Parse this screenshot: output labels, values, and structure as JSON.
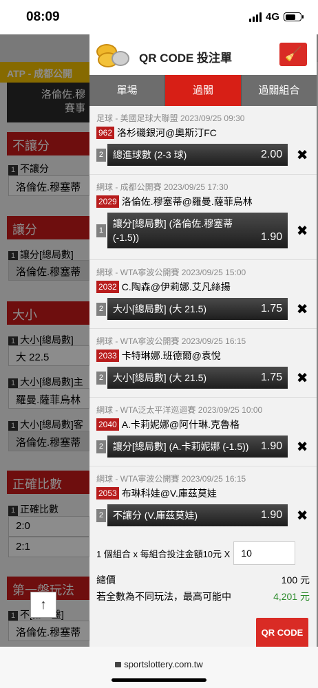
{
  "status": {
    "time": "08:09",
    "network": "4G"
  },
  "background": {
    "tournament": "ATP - 成都公開",
    "match_line1": "洛倫佐.穆",
    "match_line2": "賽事",
    "sections": [
      {
        "title": "不讓分",
        "label": "不讓分",
        "num": "1",
        "value": "洛倫佐.穆塞蒂"
      },
      {
        "title": "讓分",
        "label": "讓分[總局數]",
        "num": "1",
        "value": "洛倫佐.穆塞蒂"
      },
      {
        "title": "大小",
        "label": "大小[總局數]",
        "num": "1",
        "value": "大 22.5"
      }
    ],
    "extra": [
      {
        "label": "大小[總局數]主",
        "num": "1",
        "value": "羅曼.薩菲烏林"
      },
      {
        "label": "大小[總局數]客",
        "num": "1",
        "value": "洛倫佐.穆塞蒂"
      }
    ],
    "correct_score": {
      "title": "正確比數",
      "label": "正確比數",
      "num": "1",
      "values": [
        "2:0",
        "2:1"
      ]
    },
    "first_set": {
      "title": "第一盤玩法",
      "label": "不[第一盤]",
      "num": "1",
      "value": "洛倫佐.穆塞蒂"
    },
    "up_arrow": "↑"
  },
  "panel": {
    "title": "QR CODE 投注單",
    "tabs": [
      {
        "label": "單場",
        "active": false
      },
      {
        "label": "過關",
        "active": true
      },
      {
        "label": "過關組合",
        "active": false
      }
    ],
    "bets": [
      {
        "meta": "足球 - 美國足球大聯盟 2023/09/25 09:30",
        "code": "962",
        "match": "洛杉磯銀河@奧斯汀FC",
        "num": "2",
        "selection": "總進球數 (2-3 球)",
        "odds": "2.00"
      },
      {
        "meta": "網球 - 成都公開賽 2023/09/25 17:30",
        "code": "2029",
        "match": "洛倫佐.穆塞蒂@羅曼.薩菲烏林",
        "num": "1",
        "selection": "讓分[總局數] (洛倫佐.穆塞蒂 (-1.5))",
        "odds": "1.90"
      },
      {
        "meta": "網球 - WTA寧波公開賽 2023/09/25 15:00",
        "code": "2032",
        "match": "C.陶森@伊莉娜.艾凡絲揚",
        "num": "2",
        "selection": "大小[總局數] (大 21.5)",
        "odds": "1.75"
      },
      {
        "meta": "網球 - WTA寧波公開賽 2023/09/25 16:15",
        "code": "2033",
        "match": "卡特琳娜.班德爾@袁悅",
        "num": "2",
        "selection": "大小[總局數] (大 21.5)",
        "odds": "1.75"
      },
      {
        "meta": "網球 - WTA泛太平洋巡迴賽 2023/09/25 10:00",
        "code": "2040",
        "match": "A.卡莉妮娜@阿什琳.克魯格",
        "num": "2",
        "selection": "讓分[總局數] (A.卡莉妮娜 (-1.5))",
        "odds": "1.90"
      },
      {
        "meta": "網球 - WTA寧波公開賽 2023/09/25 16:15",
        "code": "2053",
        "match": "布琳科娃@V.庫茲莫娃",
        "num": "2",
        "selection": "不讓分 (V.庫茲莫娃)",
        "odds": "1.90"
      }
    ],
    "remove_symbol": "✖",
    "summary": {
      "combo_text": "1 個組合 x 每組合投注金額10元 X",
      "amount": "10",
      "total_label": "總價",
      "total_value": "100 元",
      "max_label": "若全數為不同玩法，最高可能中",
      "max_value": "4,201 元",
      "qr_button": "QR CODE"
    }
  },
  "browser": {
    "url": "sportslottery.com.tw"
  }
}
